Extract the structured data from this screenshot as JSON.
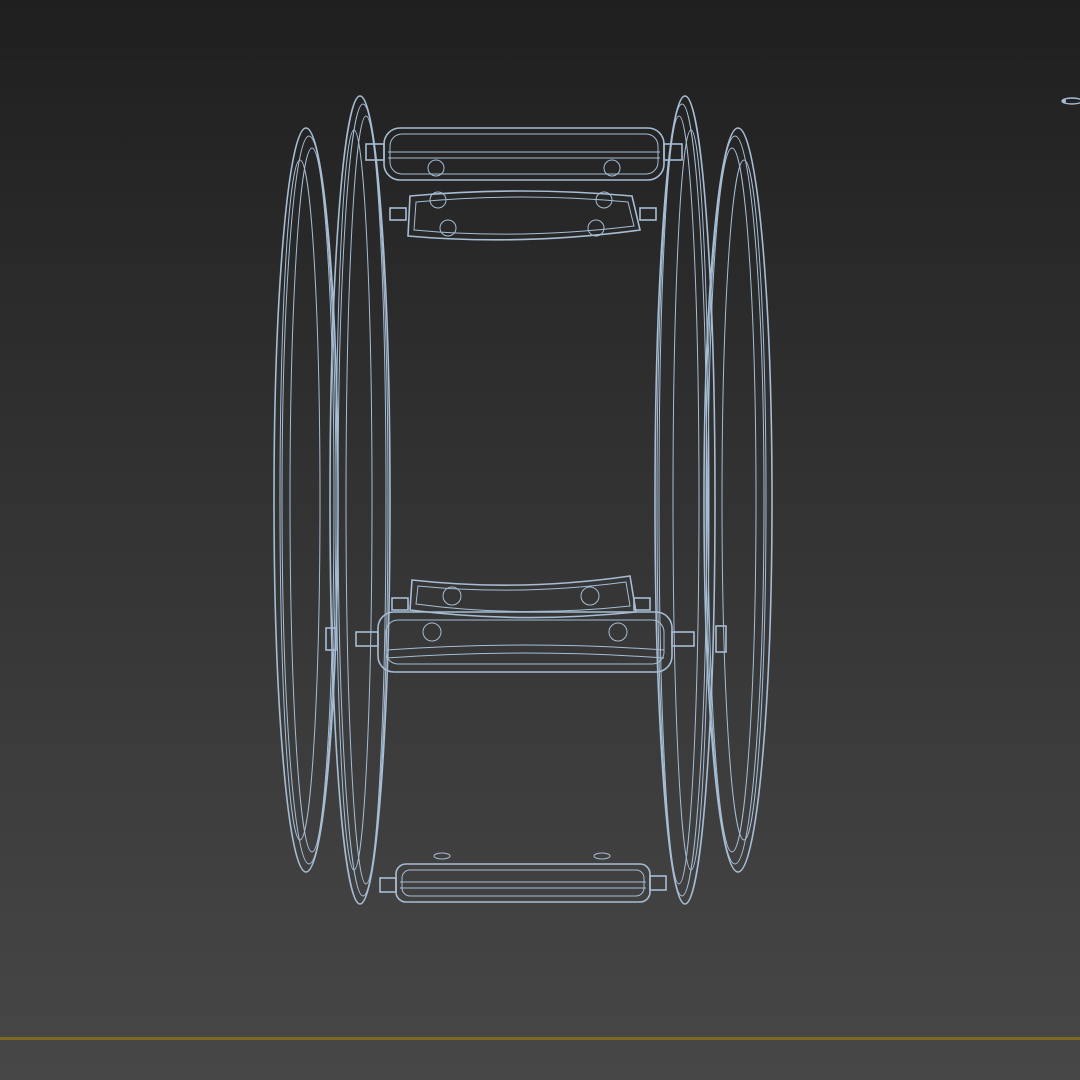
{
  "viewport": {
    "background_top": "#1f1f1f",
    "background_bottom": "#474747",
    "grid_line_color": "#7d6a22",
    "wireframe_color": "#a6bdd4",
    "wireframe_shadow": "#8ea4ba"
  },
  "model": {
    "icon": "wireframe-tracked-chassis"
  }
}
